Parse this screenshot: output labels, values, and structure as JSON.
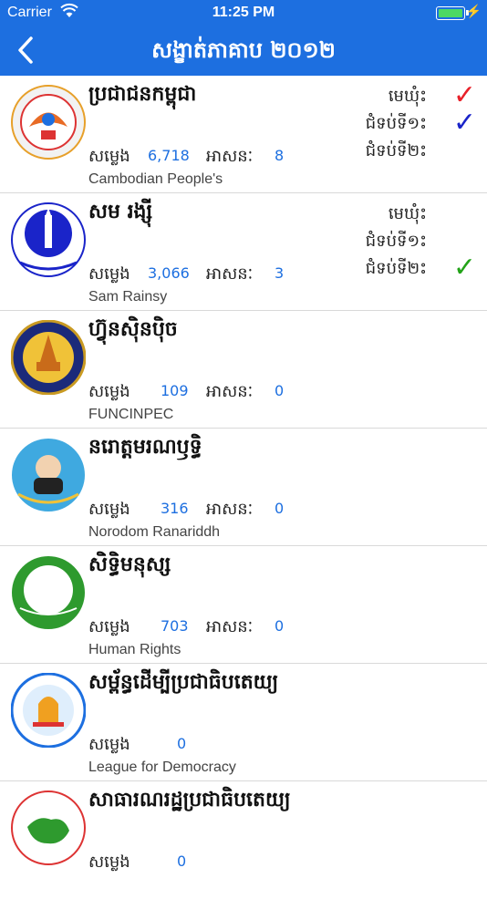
{
  "status": {
    "carrier": "Carrier",
    "time": "11:25 PM"
  },
  "nav": {
    "title": "សង្ខាត់ភាគាប ២០១២"
  },
  "labels": {
    "votes": "សម្លេង",
    "seats": "អាសនៈ",
    "commune": "មេឃុំះ",
    "deputy1": "ជំទប់ទី១ះ",
    "deputy2": "ជំទប់ទី២ះ"
  },
  "parties": [
    {
      "name": "ប្រជាជនកម្ពុជា",
      "en": "Cambodian People's",
      "votes": "6,718",
      "seats": "8",
      "checks": {
        "commune": "✓",
        "deputy1": "✓",
        "deputy2": ""
      },
      "checkColors": {
        "commune": "#e8212a",
        "deputy1": "#1a24c9"
      }
    },
    {
      "name": "សម រង្ស៊ី",
      "en": "Sam Rainsy",
      "votes": "3,066",
      "seats": "3",
      "checks": {
        "commune": "",
        "deputy1": "",
        "deputy2": "✓"
      },
      "checkColors": {
        "deputy2": "#23a319"
      }
    },
    {
      "name": "ហ៊្វុនស៊ិនប៉ិច",
      "en": "FUNCINPEC",
      "votes": "109",
      "seats": "0"
    },
    {
      "name": "នរោត្តមរណឫទ្ធិ",
      "en": "Norodom Ranariddh",
      "votes": "316",
      "seats": "0"
    },
    {
      "name": "សិទ្ធិមនុស្ស",
      "en": "Human Rights",
      "votes": "703",
      "seats": "0"
    },
    {
      "name": "សម្ព័ន្ធដើម្បីប្រជាធិបតេយ្យ",
      "en": "League for Democracy",
      "votes": "0"
    },
    {
      "name": "សាធារណរដ្ឋប្រជាធិបតេយ្យ",
      "votes": "0"
    }
  ],
  "colors": {
    "header": "#1d6fe0",
    "value": "#1d6fe0"
  }
}
